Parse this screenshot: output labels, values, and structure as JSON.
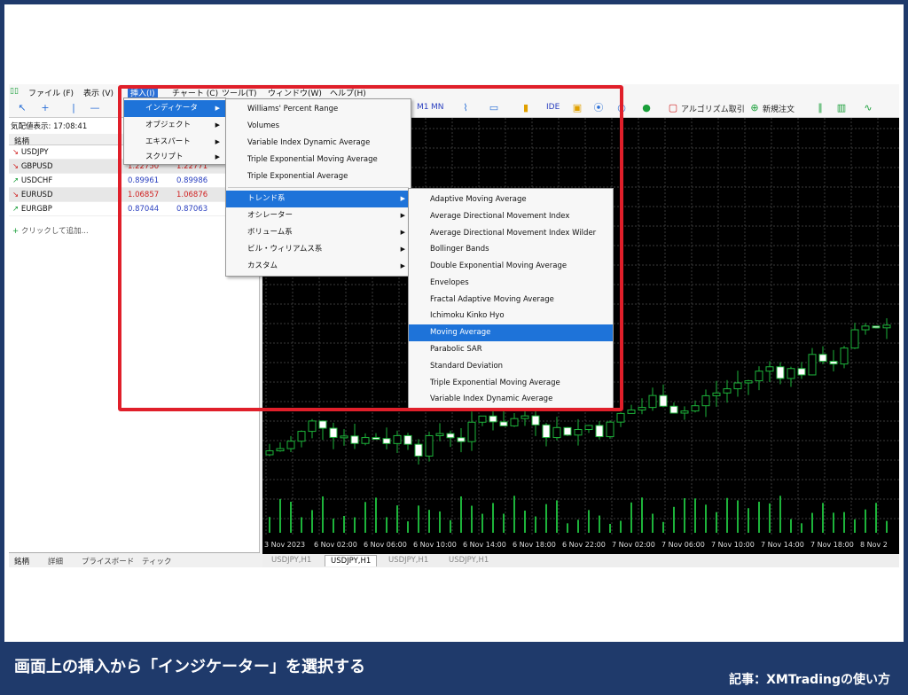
{
  "menubar": {
    "items": [
      "ファイル (F)",
      "表示 (V)",
      "挿入(I)",
      "チャート (C)",
      "ツール(T)",
      "ウィンドウ(W)",
      "ヘルプ(H)"
    ]
  },
  "toolbar": {
    "timeframes": [
      "M1",
      "MN"
    ],
    "buttons": [
      "IDE",
      "アルゴリズム取引",
      "新規注文"
    ]
  },
  "market_watch": {
    "time_label": "気配値表示: 17:08:41",
    "column_symbol": "銘柄",
    "rows": [
      {
        "symbol": "USDJPY",
        "bid": "",
        "ask": "",
        "dir": "down"
      },
      {
        "symbol": "GBPUSD",
        "bid": "1.22750",
        "ask": "1.22771",
        "dir": "down"
      },
      {
        "symbol": "USDCHF",
        "bid": "0.89961",
        "ask": "0.89986",
        "dir": "up"
      },
      {
        "symbol": "EURUSD",
        "bid": "1.06857",
        "ask": "1.06876",
        "dir": "down"
      },
      {
        "symbol": "EURGBP",
        "bid": "0.87044",
        "ask": "0.87063",
        "dir": "up"
      }
    ],
    "add_label": "クリックして追加...",
    "tabs": [
      "銘柄",
      "詳細",
      "プライスボード",
      "ティック"
    ]
  },
  "insert_menu": {
    "items": [
      "インディケータ",
      "オブジェクト",
      "エキスパート",
      "スクリプト"
    ]
  },
  "indicator_menu": {
    "items": [
      "Williams' Percent Range",
      "Volumes",
      "Variable Index Dynamic Average",
      "Triple Exponential Moving Average",
      "Triple Exponential Average"
    ],
    "groups": [
      "トレンド系",
      "オシレーター",
      "ボリューム系",
      "ビル・ウィリアムス系",
      "カスタム"
    ]
  },
  "trend_menu": {
    "items": [
      "Adaptive Moving Average",
      "Average Directional Movement Index",
      "Average Directional Movement Index Wilder",
      "Bollinger Bands",
      "Double Exponential Moving Average",
      "Envelopes",
      "Fractal Adaptive Moving Average",
      "Ichimoku Kinko Hyo",
      "Moving Average",
      "Parabolic SAR",
      "Standard Deviation",
      "Triple Exponential Moving Average",
      "Variable Index Dynamic Average"
    ]
  },
  "chart": {
    "x_labels": [
      "3 Nov 2023",
      "6 Nov 02:00",
      "6 Nov 06:00",
      "6 Nov 10:00",
      "6 Nov 14:00",
      "6 Nov 18:00",
      "6 Nov 22:00",
      "7 Nov 02:00",
      "7 Nov 06:00",
      "7 Nov 10:00",
      "7 Nov 14:00",
      "7 Nov 18:00",
      "8 Nov 2"
    ],
    "tabs": [
      "USDJPY,H1",
      "USDJPY,H1",
      "USDJPY,H1",
      "USDJPY,H1"
    ]
  },
  "footer": {
    "title": "画面上の挿入から「インジケーター」を選択する",
    "credit": "記事：XMTradingの使い方"
  },
  "colors": {
    "frame": "#1f3a6b",
    "highlight": "#e01f2a",
    "selection": "#1e73d9"
  }
}
